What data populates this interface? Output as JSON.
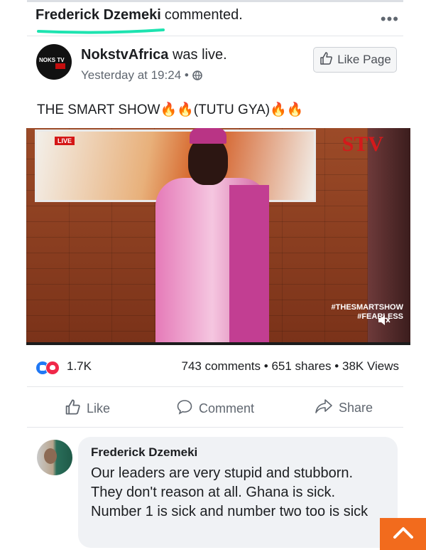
{
  "notification": {
    "commenter_name": "Frederick Dzemeki",
    "action_text": "commented."
  },
  "more_options_icon": "ellipsis-icon",
  "post": {
    "page_name": "NokstvAfrica",
    "status_text": "was live.",
    "timestamp": "Yesterday at 19:24",
    "avatar_text": "NOKS TV",
    "privacy_icon": "globe-icon",
    "like_page_label": "Like Page",
    "text": "THE SMART SHOW🔥🔥(TUTU GYA)🔥🔥"
  },
  "video": {
    "live_tag": "LIVE",
    "channel_logo": "STV",
    "hashtags": [
      "#THESMARTSHOW",
      "#FEARLESS"
    ],
    "mute_icon": "speaker-muted-icon"
  },
  "stats": {
    "reaction_count": "1.7K",
    "comments": "743 comments",
    "shares": "651 shares",
    "views": "38K Views",
    "separator": "•"
  },
  "actions": {
    "like_label": "Like",
    "comment_label": "Comment",
    "share_label": "Share"
  },
  "comment": {
    "author": "Frederick Dzemeki",
    "text": "Our leaders are very stupid and stubborn.  They don't reason at all. Ghana is sick. Number 1 is sick and number two too is sick"
  },
  "colors": {
    "underline_accent": "#1de3b0",
    "like_blue": "#2078f4",
    "love_red": "#f02849",
    "scroll_button": "#f26b1d"
  }
}
